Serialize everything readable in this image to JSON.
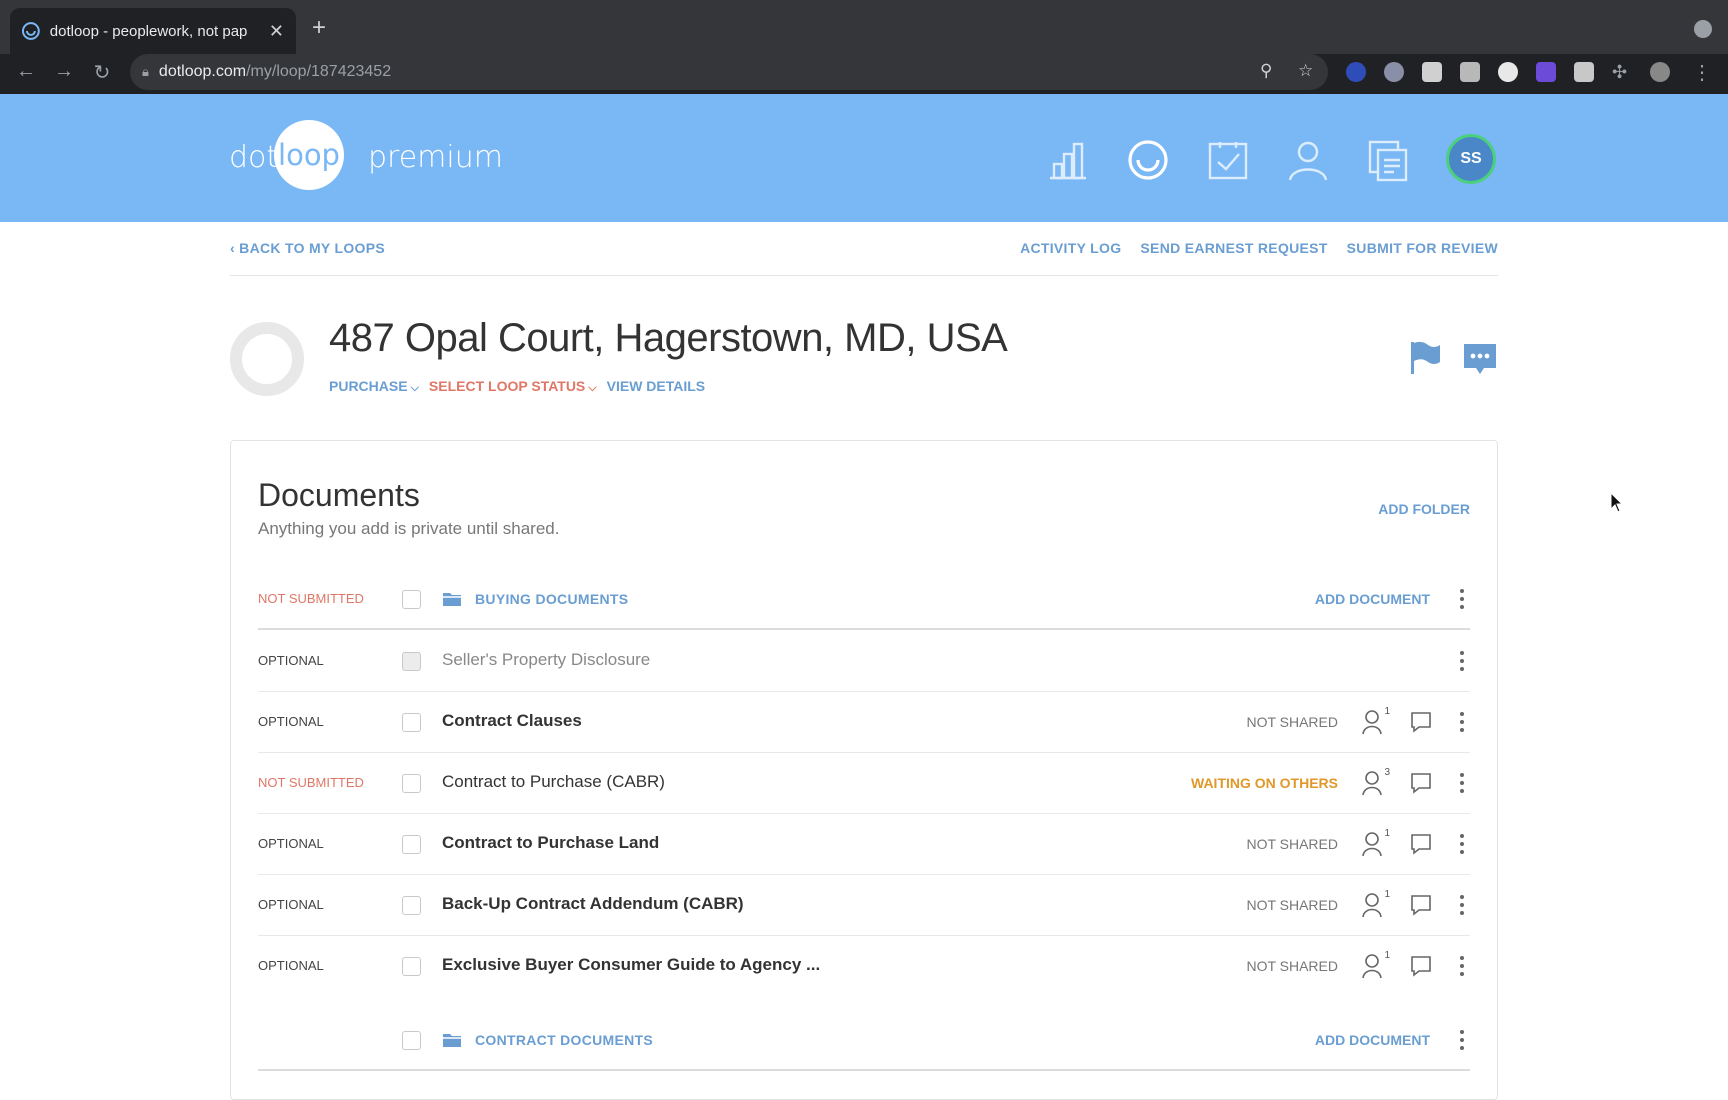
{
  "browser": {
    "tab_title": "dotloop - peoplework, not pap",
    "tab_close": "✕",
    "new_tab": "+",
    "url_host": "dotloop.com",
    "url_path": "/my/loop/187423452"
  },
  "header": {
    "logo_dot": "dot",
    "logo_loop": "loop",
    "logo_premium": "premium",
    "avatar_initials": "SS"
  },
  "subnav": {
    "back": "BACK TO MY LOOPS",
    "activity_log": "ACTIVITY LOG",
    "send_earnest": "SEND EARNEST REQUEST",
    "submit_review": "SUBMIT FOR REVIEW"
  },
  "loop": {
    "title": "487 Opal Court, Hagerstown, MD, USA",
    "transaction_type": "PURCHASE",
    "loop_status": "SELECT LOOP STATUS",
    "view_details": "VIEW DETAILS"
  },
  "documents": {
    "title": "Documents",
    "subtitle": "Anything you add is private until shared.",
    "add_folder": "ADD FOLDER",
    "folders": [
      {
        "status": "NOT SUBMITTED",
        "name": "BUYING DOCUMENTS",
        "add_label": "ADD DOCUMENT"
      },
      {
        "status": "",
        "name": "CONTRACT DOCUMENTS",
        "add_label": "ADD DOCUMENT"
      }
    ],
    "rows": [
      {
        "status": "OPTIONAL",
        "name": "Seller's Property Disclosure",
        "share": "",
        "people": ""
      },
      {
        "status": "OPTIONAL",
        "name": "Contract Clauses",
        "share": "NOT SHARED",
        "people": "1"
      },
      {
        "status": "NOT SUBMITTED",
        "name": "Contract to Purchase (CABR)",
        "share": "WAITING ON OTHERS",
        "people": "3"
      },
      {
        "status": "OPTIONAL",
        "name": "Contract to Purchase Land",
        "share": "NOT SHARED",
        "people": "1"
      },
      {
        "status": "OPTIONAL",
        "name": "Back-Up Contract Addendum (CABR)",
        "share": "NOT SHARED",
        "people": "1"
      },
      {
        "status": "OPTIONAL",
        "name": "Exclusive Buyer Consumer Guide to Agency ...",
        "share": "NOT SHARED",
        "people": "1"
      }
    ]
  },
  "colors": {
    "header_bg": "#7ab8f5",
    "link_blue": "#6a9ed2",
    "status_red": "#e07766",
    "waiting_orange": "#e0982a",
    "avatar_ring": "#4bd07d"
  }
}
